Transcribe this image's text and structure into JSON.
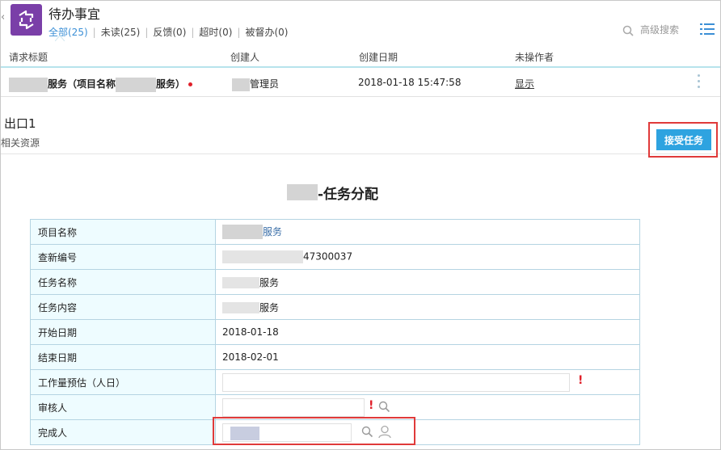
{
  "app": {
    "title": "待办事宜"
  },
  "filters": [
    {
      "label": "全部(25)",
      "active": true
    },
    {
      "label": "未读(25)",
      "active": false
    },
    {
      "label": "反馈(0)",
      "active": false
    },
    {
      "label": "超时(0)",
      "active": false
    },
    {
      "label": "被督办(0)",
      "active": false
    }
  ],
  "search": {
    "label": "高级搜索"
  },
  "list": {
    "headers": {
      "title": "请求标题",
      "creator": "创建人",
      "date": "创建日期",
      "operator": "未操作者"
    },
    "row": {
      "title_part1": "服务（项目名称",
      "title_part2": "服务）",
      "creator": "管理员",
      "date": "2018-01-18 15:47:58",
      "operator": "显示"
    }
  },
  "detail": {
    "title": "出口1",
    "subtitle": "相关资源",
    "accept_label": "接受任务"
  },
  "form": {
    "title": "-任务分配",
    "rows": [
      {
        "label": "项目名称",
        "value": "服务"
      },
      {
        "label": "查新编号",
        "value": "47300037"
      },
      {
        "label": "任务名称",
        "value": "服务"
      },
      {
        "label": "任务内容",
        "value": "服务"
      },
      {
        "label": "开始日期",
        "value": "2018-01-18"
      },
      {
        "label": "结束日期",
        "value": "2018-02-01"
      },
      {
        "label": "工作量预估（人日）",
        "value": ""
      },
      {
        "label": "审核人",
        "value": ""
      },
      {
        "label": "完成人",
        "value": ""
      }
    ],
    "required_mark": "!"
  }
}
